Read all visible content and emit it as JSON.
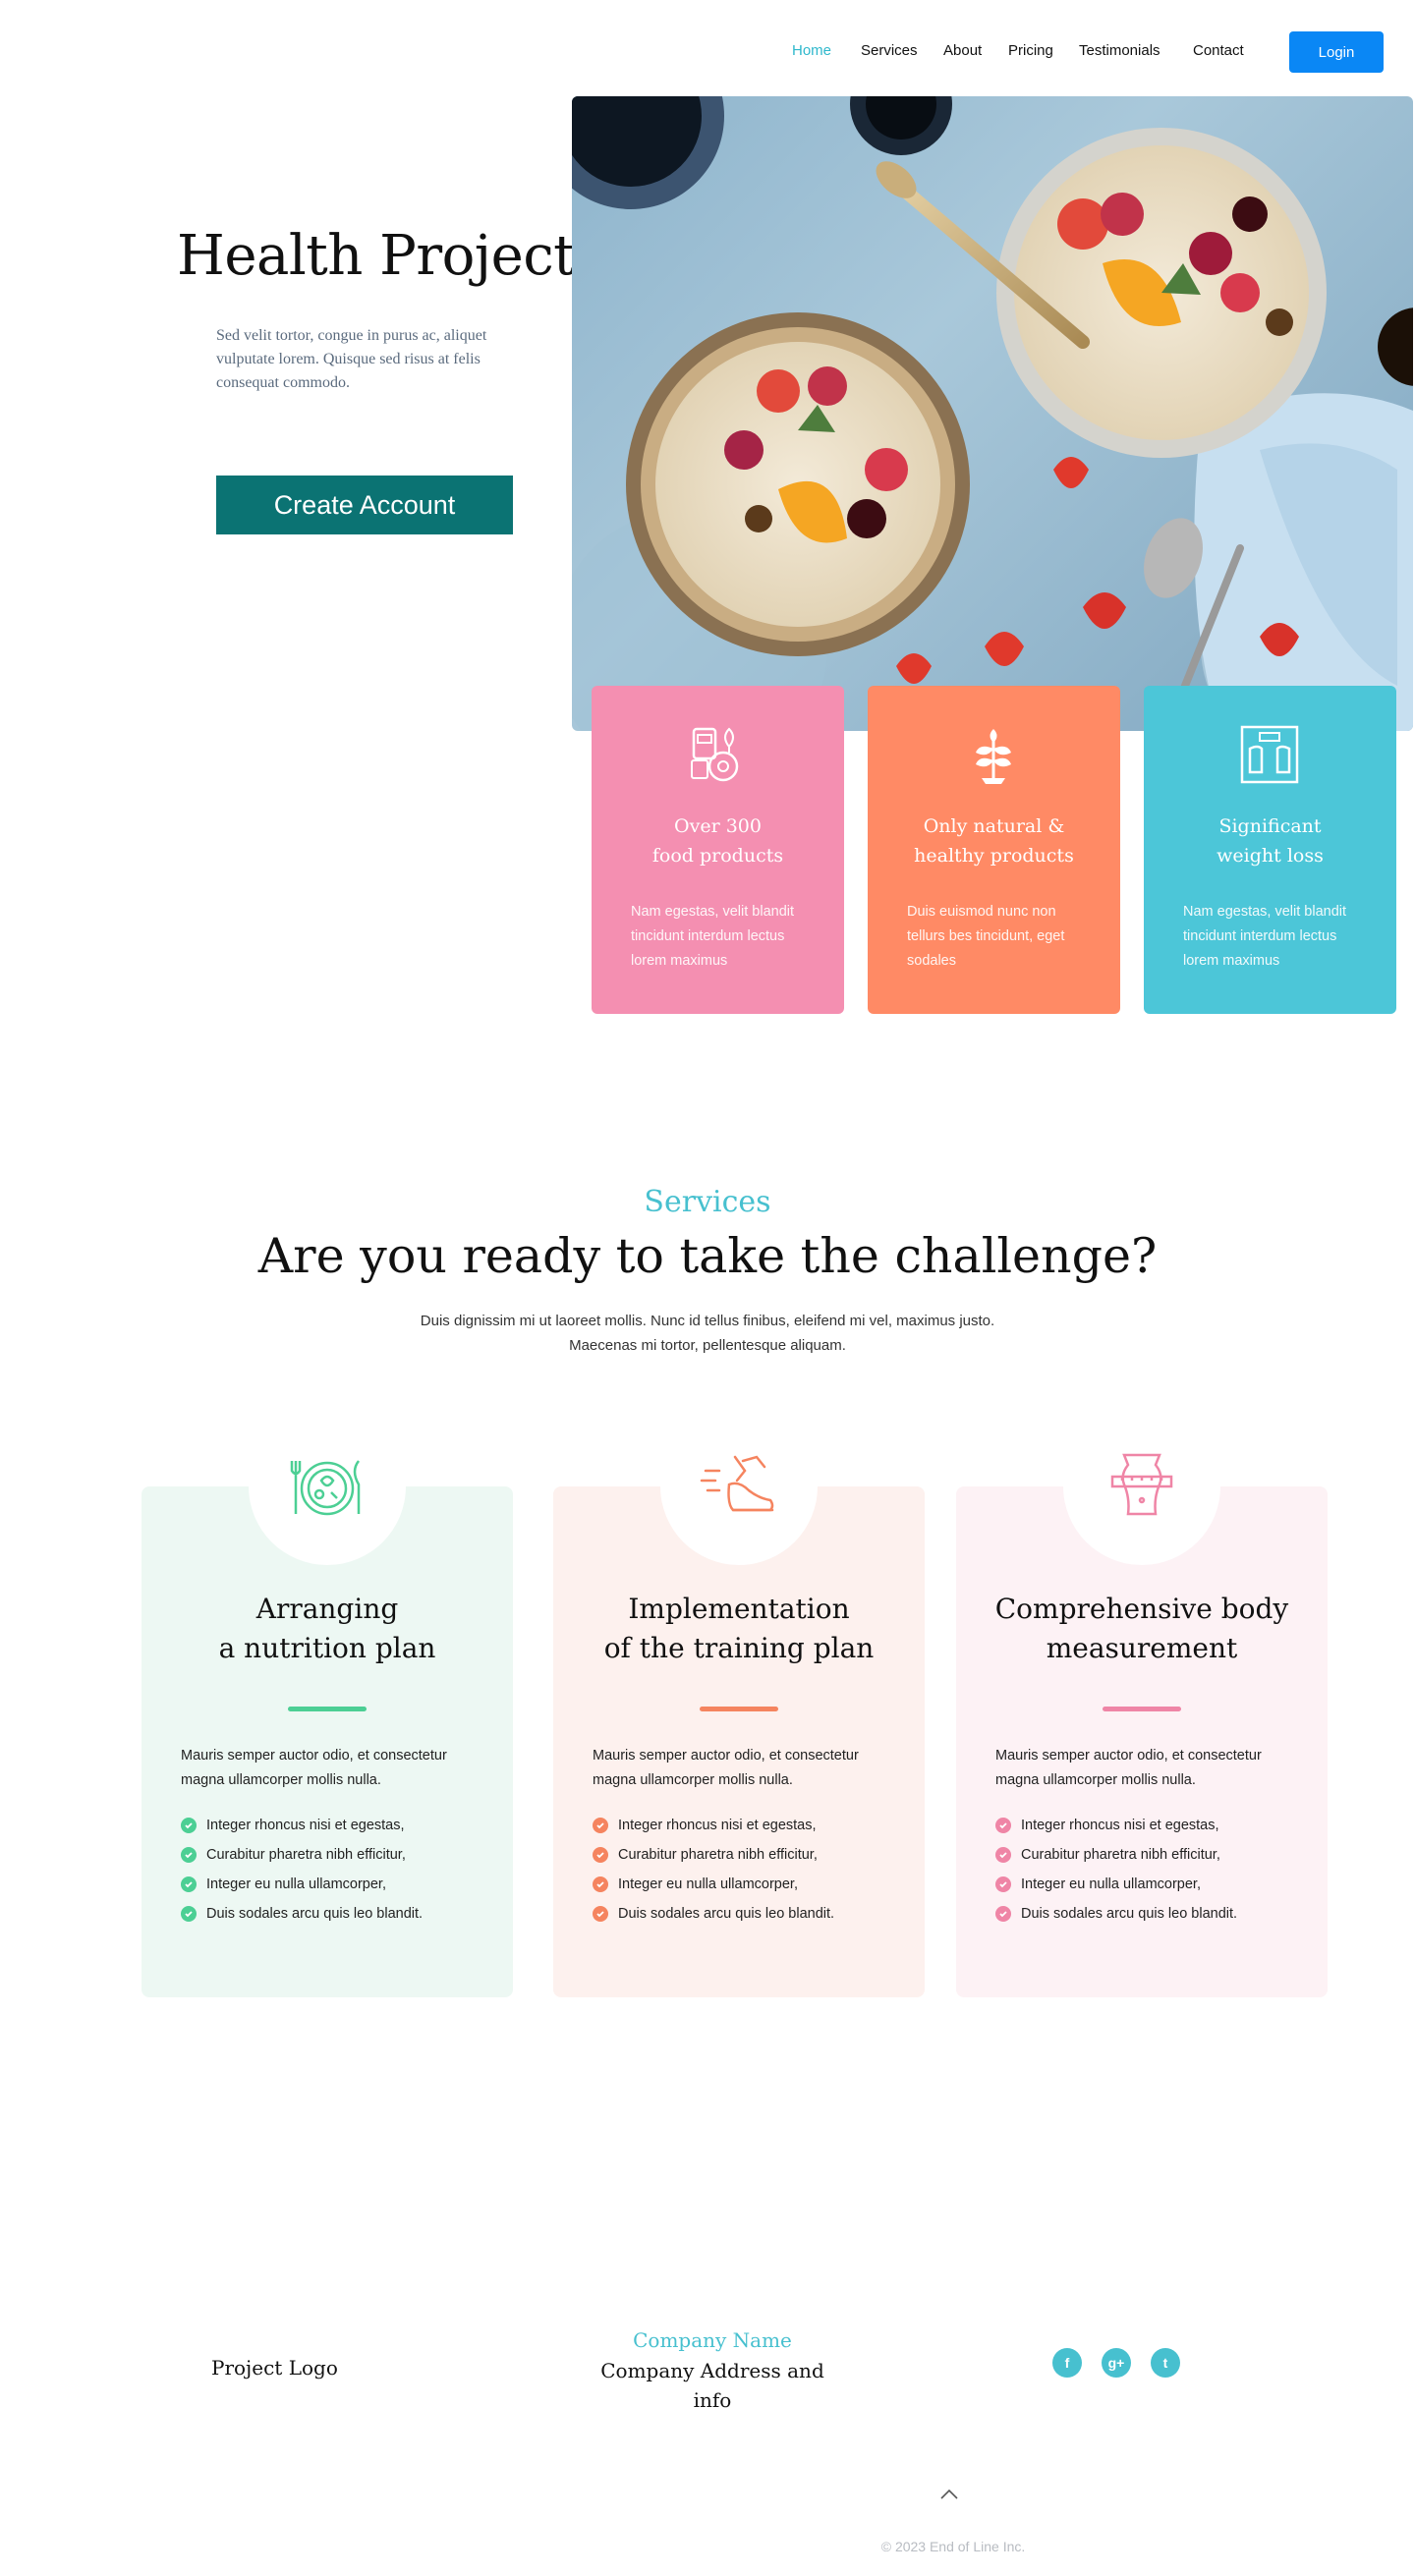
{
  "nav": {
    "items": [
      {
        "label": "Home",
        "active": true
      },
      {
        "label": "Services",
        "active": false
      },
      {
        "label": "About",
        "active": false
      },
      {
        "label": "Pricing",
        "active": false
      },
      {
        "label": "Testimonials",
        "active": false
      },
      {
        "label": "Contact",
        "active": false
      }
    ],
    "login_label": "Login"
  },
  "hero": {
    "title": "Health Project",
    "text": "Sed velit tortor, congue in purus ac, aliquet vulputate lorem. Quisque sed risus at felis consequat commodo.",
    "cta_label": "Create Account"
  },
  "features": [
    {
      "icon": "food-products-icon",
      "title": "Over 300\nfood products",
      "text": "Nam egestas, velit blandit tincidunt interdum lectus lorem maximus",
      "color": "#f48fb1"
    },
    {
      "icon": "plant-icon",
      "title": "Only natural &\nhealthy products",
      "text": "Duis euismod nunc non tellurs bes tincidunt, eget sodales",
      "color": "#ff8a65"
    },
    {
      "icon": "scale-icon",
      "title": "Significant\nweight loss",
      "text": "Nam egestas, velit blandit tincidunt interdum lectus lorem maximus",
      "color": "#4cc6d8"
    }
  ],
  "services": {
    "kicker": "Services",
    "title": "Are you ready to take the challenge?",
    "subtitle": "Duis dignissim mi ut laoreet mollis. Nunc id tellus finibus, eleifend mi vel, maximus justo. Maecenas mi tortor, pellentesque aliquam.",
    "cards": [
      {
        "icon": "nutrition-plate-icon",
        "title": "Arranging\na nutrition plan",
        "desc": "Mauris semper auctor odio, et consectetur magna ullamcorper mollis nulla.",
        "items": [
          "Integer rhoncus nisi et egestas,",
          "Curabitur pharetra nibh efficitur,",
          "Integer eu nulla ullamcorper,",
          "Duis sodales arcu quis leo blandit."
        ],
        "accent": "#4ccf94",
        "bg": "#edf8f3"
      },
      {
        "icon": "running-shoe-icon",
        "title": "Implementation\nof the training plan",
        "desc": "Mauris semper auctor odio, et consectetur magna ullamcorper mollis nulla.",
        "items": [
          "Integer rhoncus nisi et egestas,",
          "Curabitur pharetra nibh efficitur,",
          "Integer eu nulla ullamcorper,",
          "Duis sodales arcu quis leo blandit."
        ],
        "accent": "#f5845f",
        "bg": "#fdf1ee"
      },
      {
        "icon": "body-measurement-icon",
        "title": "Comprehensive body\nmeasurement",
        "desc": "Mauris semper auctor odio, et consectetur magna ullamcorper mollis nulla.",
        "items": [
          "Integer rhoncus nisi et egestas,",
          "Curabitur pharetra nibh efficitur,",
          "Integer eu nulla ullamcorper,",
          "Duis sodales arcu quis leo blandit."
        ],
        "accent": "#ef85a6",
        "bg": "#fdf2f5"
      }
    ]
  },
  "footer": {
    "logo": "Project Logo",
    "company_name": "Company Name",
    "address": "Company Address and info",
    "social": [
      {
        "icon": "facebook-icon",
        "glyph": "f"
      },
      {
        "icon": "google-plus-icon",
        "glyph": "g+"
      },
      {
        "icon": "twitter-icon",
        "glyph": "t"
      }
    ],
    "copyright": "© 2023 End of Line Inc."
  },
  "colors": {
    "brand_teal": "#0b7373",
    "accent_cyan": "#47c0cf",
    "login_blue": "#0a87f5"
  }
}
